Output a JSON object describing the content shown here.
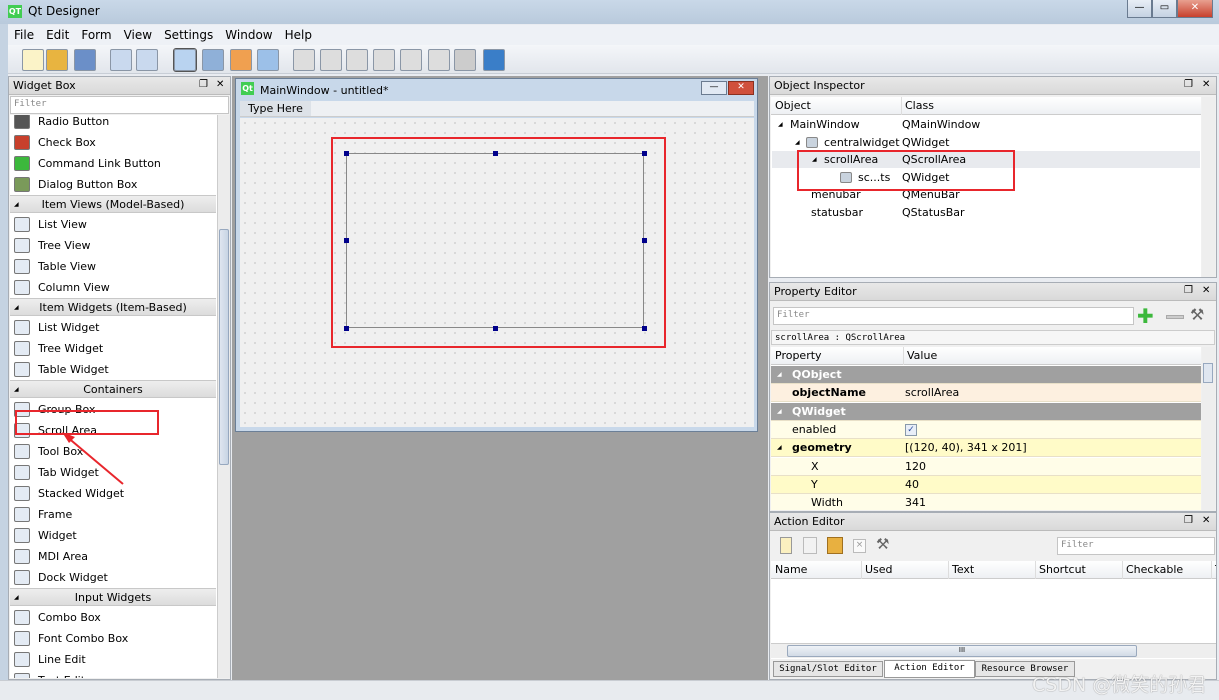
{
  "window": {
    "title": "Qt Designer",
    "logo": "QT",
    "minimize": "—",
    "maximize": "▭",
    "close": "✕"
  },
  "menu": [
    "File",
    "Edit",
    "Form",
    "View",
    "Settings",
    "Window",
    "Help"
  ],
  "toolbar_icons": [
    "new-icon",
    "open-icon",
    "save-icon",
    "send-to-back-icon",
    "bring-to-front-icon",
    "edit-widgets-icon",
    "edit-signals-slots-icon",
    "edit-buddies-icon",
    "edit-tab-order-icon",
    "layout-horizontal-icon",
    "layout-vertical-icon",
    "layout-horizontal-splitter-icon",
    "layout-vertical-splitter-icon",
    "layout-grid-icon",
    "layout-form-icon",
    "break-layout-icon",
    "adjust-size-icon"
  ],
  "widget_box": {
    "title": "Widget Box",
    "filter_placeholder": "Filter",
    "items": [
      {
        "label": "Radio Button",
        "icon": "radio-button-icon"
      },
      {
        "label": "Check Box",
        "icon": "check-box-icon"
      },
      {
        "label": "Command Link Button",
        "icon": "command-link-icon"
      },
      {
        "label": "Dialog Button Box",
        "icon": "dialog-button-box-icon"
      },
      {
        "category": "Item Views (Model-Based)"
      },
      {
        "label": "List View",
        "icon": "list-view-icon"
      },
      {
        "label": "Tree View",
        "icon": "tree-view-icon"
      },
      {
        "label": "Table View",
        "icon": "table-view-icon"
      },
      {
        "label": "Column View",
        "icon": "column-view-icon"
      },
      {
        "category": "Item Widgets (Item-Based)"
      },
      {
        "label": "List Widget",
        "icon": "list-widget-icon"
      },
      {
        "label": "Tree Widget",
        "icon": "tree-widget-icon"
      },
      {
        "label": "Table Widget",
        "icon": "table-widget-icon"
      },
      {
        "category": "Containers"
      },
      {
        "label": "Group Box",
        "icon": "group-box-icon"
      },
      {
        "label": "Scroll Area",
        "icon": "scroll-area-icon"
      },
      {
        "label": "Tool Box",
        "icon": "tool-box-icon"
      },
      {
        "label": "Tab Widget",
        "icon": "tab-widget-icon"
      },
      {
        "label": "Stacked Widget",
        "icon": "stacked-widget-icon"
      },
      {
        "label": "Frame",
        "icon": "frame-icon"
      },
      {
        "label": "Widget",
        "icon": "widget-icon"
      },
      {
        "label": "MDI Area",
        "icon": "mdi-area-icon"
      },
      {
        "label": "Dock Widget",
        "icon": "dock-widget-icon"
      },
      {
        "category": "Input Widgets"
      },
      {
        "label": "Combo Box",
        "icon": "combo-box-icon"
      },
      {
        "label": "Font Combo Box",
        "icon": "font-combo-box-icon"
      },
      {
        "label": "Line Edit",
        "icon": "line-edit-icon"
      },
      {
        "label": "Text Edit",
        "icon": "text-edit-icon"
      }
    ]
  },
  "form": {
    "title": "MainWindow - untitled*",
    "logo": "Qt",
    "menu_placeholder": "Type Here"
  },
  "object_inspector": {
    "title": "Object Inspector",
    "columns": [
      "Object",
      "Class"
    ],
    "rows": [
      {
        "object": "MainWindow",
        "class": "QMainWindow",
        "level": 0,
        "expanded": true
      },
      {
        "object": "centralwidget",
        "class": "QWidget",
        "level": 1,
        "expanded": true
      },
      {
        "object": "scrollArea",
        "class": "QScrollArea",
        "level": 2,
        "expanded": true,
        "selected": true
      },
      {
        "object": "sc...ts",
        "class": "QWidget",
        "level": 3
      },
      {
        "object": "menubar",
        "class": "QMenuBar",
        "level": 1
      },
      {
        "object": "statusbar",
        "class": "QStatusBar",
        "level": 1
      }
    ]
  },
  "property_editor": {
    "title": "Property Editor",
    "filter_placeholder": "Filter",
    "object_label": "scrollArea : QScrollArea",
    "columns": [
      "Property",
      "Value"
    ],
    "rows": [
      {
        "group": "QObject"
      },
      {
        "property": "objectName",
        "value": "scrollArea",
        "bold": true,
        "bg": "#fdf0e0"
      },
      {
        "group": "QWidget"
      },
      {
        "property": "enabled",
        "value": "✓",
        "check": true,
        "bg": "#fffde8"
      },
      {
        "property": "geometry",
        "value": "[(120, 40), 341 x 201]",
        "bold": true,
        "expander": true,
        "bg": "#fffbc8"
      },
      {
        "property": "X",
        "value": "120",
        "indent": true,
        "bg": "#fffde8"
      },
      {
        "property": "Y",
        "value": "40",
        "indent": true,
        "bg": "#fffbc8"
      },
      {
        "property": "Width",
        "value": "341",
        "indent": true,
        "bg": "#fffde8"
      }
    ]
  },
  "action_editor": {
    "title": "Action Editor",
    "filter_placeholder": "Filter",
    "columns": [
      "Name",
      "Used",
      "Text",
      "Shortcut",
      "Checkable",
      "T"
    ]
  },
  "bottom_tabs": [
    "Signal/Slot Editor",
    "Action Editor",
    "Resource Browser"
  ],
  "watermark": "CSDN @微笑的孙君",
  "colors": {
    "annotation_red": "#e8262c",
    "selection_handle": "#00008b",
    "group_row": "#a0a0a0"
  }
}
